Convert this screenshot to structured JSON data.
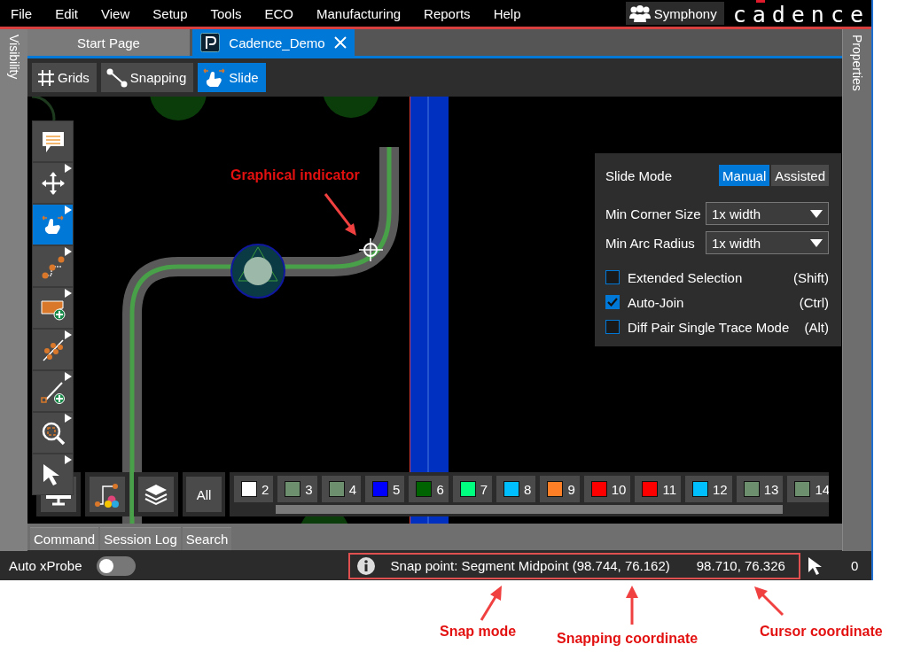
{
  "menu": [
    "File",
    "Edit",
    "View",
    "Setup",
    "Tools",
    "ECO",
    "Manufacturing",
    "Reports",
    "Help"
  ],
  "symphony_button": "Symphony",
  "logo": "cadence",
  "side_panels": {
    "left": "Visibility",
    "right": "Properties"
  },
  "tabs": [
    {
      "label": "Start Page",
      "selected": false,
      "closable": false
    },
    {
      "label": "Cadence_Demo",
      "selected": true,
      "closable": true
    }
  ],
  "toolbar": [
    {
      "label": "Grids",
      "kind": "grid",
      "selected": false
    },
    {
      "label": "Snapping",
      "kind": "snap",
      "selected": false
    },
    {
      "label": "Slide",
      "kind": "hand",
      "selected": true
    }
  ],
  "tools": [
    {
      "kind": "comment",
      "selected": false,
      "has_menu": false
    },
    {
      "kind": "move",
      "selected": false,
      "has_menu": true
    },
    {
      "kind": "hand",
      "selected": true,
      "has_menu": true
    },
    {
      "kind": "route",
      "selected": false,
      "has_menu": true
    },
    {
      "kind": "shape",
      "selected": false,
      "has_menu": true
    },
    {
      "kind": "fanout",
      "selected": false,
      "has_menu": true
    },
    {
      "kind": "line",
      "selected": false,
      "has_menu": true
    },
    {
      "kind": "zoom",
      "selected": false,
      "has_menu": true
    },
    {
      "kind": "pointer",
      "selected": false,
      "has_menu": true
    }
  ],
  "canvas_note": "Graphical indicator",
  "slide_panel": {
    "title": "Slide Mode",
    "modes": [
      {
        "label": "Manual",
        "selected": true
      },
      {
        "label": "Assisted",
        "selected": false
      }
    ],
    "dropdowns": [
      {
        "label": "Min Corner Size",
        "value": "1x width"
      },
      {
        "label": "Min Arc Radius",
        "value": "1x width"
      }
    ],
    "options": [
      {
        "label": "Extended Selection",
        "shortcut": "(Shift)",
        "checked": false
      },
      {
        "label": "Auto-Join",
        "shortcut": "(Ctrl)",
        "checked": true
      },
      {
        "label": "Diff Pair Single Trace Mode",
        "shortcut": "(Alt)",
        "checked": false
      }
    ]
  },
  "bottom_buttons": [
    {
      "kind": "monitor"
    },
    {
      "kind": "routecolor"
    },
    {
      "kind": "layers"
    },
    {
      "kind": "text",
      "label": "All"
    }
  ],
  "layers": [
    {
      "label": "2",
      "color": "#ffffff"
    },
    {
      "label": "3",
      "color": "#6e8f6e"
    },
    {
      "label": "4",
      "color": "#6e8f6e"
    },
    {
      "label": "5",
      "color": "#0000ff"
    },
    {
      "label": "6",
      "color": "#006400"
    },
    {
      "label": "7",
      "color": "#00ff7f"
    },
    {
      "label": "8",
      "color": "#00bfff"
    },
    {
      "label": "9",
      "color": "#ff7f27"
    },
    {
      "label": "10",
      "color": "#ff0000"
    },
    {
      "label": "11",
      "color": "#ff0000"
    },
    {
      "label": "12",
      "color": "#00bfff"
    },
    {
      "label": "13",
      "color": "#6e8f6e"
    },
    {
      "label": "14",
      "color": "#6e8f6e"
    }
  ],
  "panel_tabs": [
    "Command",
    "Session Log",
    "Search"
  ],
  "status_bar": {
    "auto_xprobe": {
      "label": "Auto xProbe",
      "on": false
    },
    "snap_text": "Snap point: Segment Midpoint (98.744, 76.162)",
    "cursor": "98.710, 76.326",
    "count": "0"
  },
  "annotations": [
    "Snap mode",
    "Snapping coordinate",
    "Cursor coordinate"
  ]
}
